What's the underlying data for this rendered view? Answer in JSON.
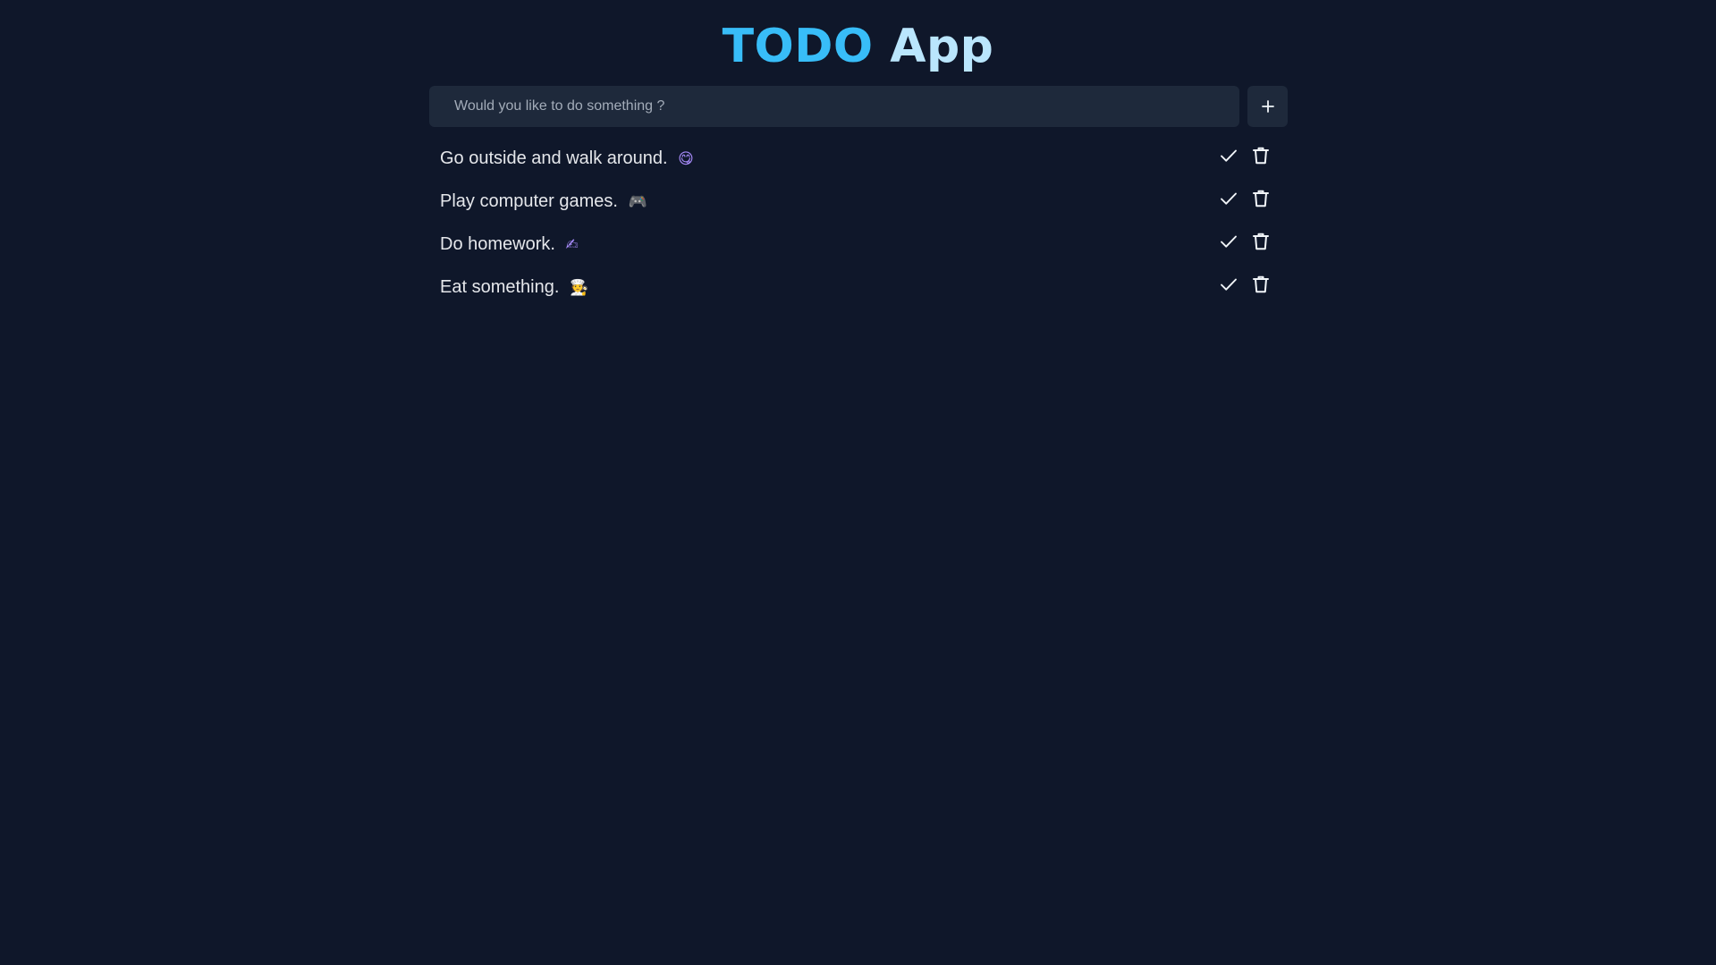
{
  "header": {
    "title_part1": "TODO",
    "title_part2": "App"
  },
  "form": {
    "placeholder": "Would you like to do something ?",
    "value": "",
    "add_icon": "plus-icon"
  },
  "todos": [
    {
      "text": "Go outside and walk around.",
      "emoji": "😋",
      "check_icon": "check-icon",
      "delete_icon": "trash-icon"
    },
    {
      "text": "Play computer games.",
      "emoji": "🎮",
      "check_icon": "check-icon",
      "delete_icon": "trash-icon"
    },
    {
      "text": "Do homework.",
      "emoji": "✍",
      "check_icon": "check-icon",
      "delete_icon": "trash-icon"
    },
    {
      "text": "Eat something.",
      "emoji": "🧑‍🍳",
      "check_icon": "check-icon",
      "delete_icon": "trash-icon"
    }
  ],
  "colors": {
    "background": "#0f172a",
    "panel": "#1e293b",
    "title_primary": "#38bdf8",
    "title_secondary": "#bae6fd",
    "text": "#e5e7eb"
  }
}
